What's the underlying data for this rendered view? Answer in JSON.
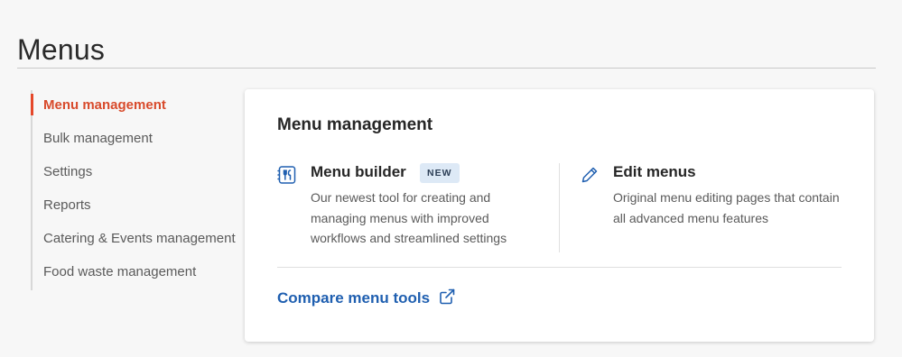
{
  "page": {
    "title": "Menus"
  },
  "sidebar": {
    "items": [
      {
        "label": "Menu management",
        "active": true
      },
      {
        "label": "Bulk management",
        "active": false
      },
      {
        "label": "Settings",
        "active": false
      },
      {
        "label": "Reports",
        "active": false
      },
      {
        "label": "Catering & Events management",
        "active": false
      },
      {
        "label": "Food waste management",
        "active": false
      }
    ]
  },
  "card": {
    "title": "Menu management",
    "tools": [
      {
        "name": "Menu builder",
        "badge": "NEW",
        "icon": "menu-builder-icon",
        "description": "Our newest tool for creating and managing menus with improved workflows and streamlined settings"
      },
      {
        "name": "Edit menus",
        "icon": "pencil-icon",
        "description": "Original menu editing pages that contain all advanced menu features"
      }
    ],
    "compare_link": {
      "label": "Compare menu tools",
      "icon": "external-link-icon"
    }
  },
  "colors": {
    "accent_active": "#d84a2b",
    "link": "#1f5fb0",
    "badge_bg": "#dde9f6"
  }
}
